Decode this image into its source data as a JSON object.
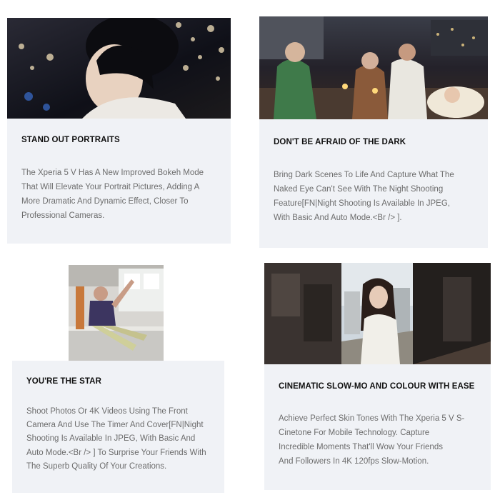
{
  "cards": [
    {
      "title": "STAND OUT PORTRAITS",
      "lines": [
        "The Xperia 5 V Has A New Improved Bokeh Mode",
        "That Will Elevate Your Portrait Pictures, Adding A",
        "More Dramatic And Dynamic Effect, Closer To",
        "Professional Cameras."
      ]
    },
    {
      "title": "DON'T BE AFRAID OF THE DARK",
      "lines": [
        "Bring Dark Scenes To Life And Capture What The",
        "Naked Eye Can't See With The Night Shooting",
        "Feature[FN|Night Shooting Is Available In JPEG,",
        "With Basic And Auto Mode.<Br /> ]."
      ]
    },
    {
      "title": "YOU'RE THE STAR",
      "lines": [
        "Shoot Photos Or 4K Videos Using The Front",
        "Camera And Use The Timer And Cover[FN|Night",
        "Shooting Is Available In JPEG, With Basic And",
        "Auto Mode.<Br /> ] To Surprise Your Friends With",
        "The Superb Quality Of Your Creations."
      ]
    },
    {
      "title": "CINEMATIC SLOW-MO AND COLOUR WITH EASE",
      "lines": [
        "Achieve Perfect Skin Tones With The Xperia 5 V S-",
        "Cinetone For Mobile Technology. Capture",
        "Incredible Moments That'll Wow Your Friends",
        "And Followers In 4K 120fps Slow-Motion."
      ]
    }
  ],
  "colors": {
    "panel_background": "#f0f2f6",
    "title_text": "#111111",
    "body_text": "#6d6d6d"
  }
}
